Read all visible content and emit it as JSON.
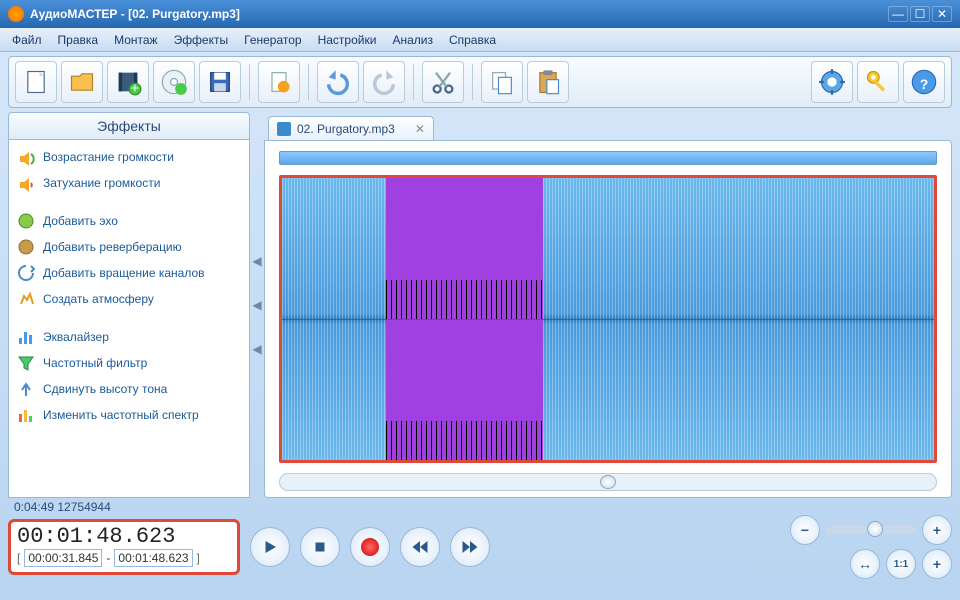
{
  "window": {
    "title": "АудиоМАСТЕР - [02. Purgatory.mp3]"
  },
  "menu": [
    "Файл",
    "Правка",
    "Монтаж",
    "Эффекты",
    "Генератор",
    "Настройки",
    "Анализ",
    "Справка"
  ],
  "toolbar": {
    "new": "new-file",
    "open": "open-file",
    "video": "video",
    "cd": "cd-disc",
    "save": "save",
    "trim": "trim-tool",
    "undo": "undo",
    "redo": "redo",
    "cut": "cut",
    "copy": "copy",
    "paste": "paste",
    "settings": "settings",
    "keys": "keys",
    "help": "help"
  },
  "sidebar": {
    "title": "Эффекты",
    "items": [
      {
        "icon": "volume-up-icon",
        "label": "Возрастание громкости"
      },
      {
        "icon": "volume-down-icon",
        "label": "Затухание громкости"
      },
      {
        "gap": true
      },
      {
        "icon": "echo-icon",
        "label": "Добавить эхо"
      },
      {
        "icon": "reverb-icon",
        "label": "Добавить реверберацию"
      },
      {
        "icon": "rotate-icon",
        "label": "Добавить вращение каналов"
      },
      {
        "icon": "atmosphere-icon",
        "label": "Создать атмосферу"
      },
      {
        "gap": true
      },
      {
        "icon": "equalizer-icon",
        "label": "Эквалайзер"
      },
      {
        "icon": "filter-icon",
        "label": "Частотный фильтр"
      },
      {
        "icon": "pitch-icon",
        "label": "Сдвинуть высоту тона"
      },
      {
        "icon": "spectrum-icon",
        "label": "Изменить частотный спектр"
      }
    ]
  },
  "tab": {
    "label": "02. Purgatory.mp3"
  },
  "status": {
    "text": "0:04:49 12754944"
  },
  "time": {
    "current": "00:01:48.623",
    "sel_start": "00:00:31.845",
    "sel_sep": "-",
    "sel_end": "00:01:48.623"
  },
  "zoom": {
    "minus": "−",
    "plus": "+",
    "fit": "↔",
    "one": "1:1"
  }
}
